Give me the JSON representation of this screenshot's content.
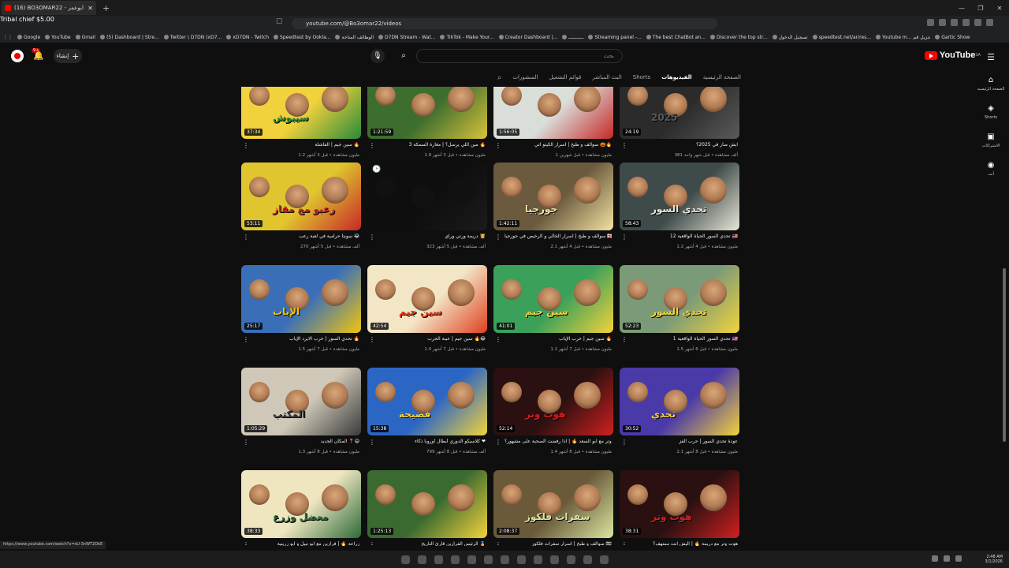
{
  "browser": {
    "tab_title": "(16) BO3OMAR22 - ابوعمر - YouTube",
    "overlay_text": "Tribal chief $5.00",
    "url": "youtube.com/@Bo3omar22/videos",
    "status_url": "https://www.youtube.com/watch?v=sU-3nWT2OkE",
    "bookmarks": [
      "Google",
      "YouTube",
      "Gmail",
      "(5) Dashboard | Stre...",
      "Twitter \\ D7DN (xD7...",
      "xD7DN - Twitch",
      "Speedtest by Ookla...",
      "الوظائف المتاحة",
      "D7DN Stream - Wat...",
      "TikTok - Make Your...",
      "Creator Dashboard |...",
      "ـــــــــــ",
      "Streaming panel -...",
      "The best ChatBot an...",
      "Discover the top str...",
      "تسجيل الدخول",
      "speedtest.net/ar/res...",
      "Youtube m... تنزيل قم",
      "Gartic Show"
    ]
  },
  "header": {
    "logo_text": "YouTube",
    "logo_region": "SA",
    "search_placeholder": "بحث",
    "create_label": "إنشاء",
    "notif_count": "9+"
  },
  "subnav": {
    "items": [
      "الصفحة الرئيسية",
      "الفيديوهات",
      "Shorts",
      "البث المباشر",
      "قوائم التشغيل",
      "المنشورات"
    ],
    "active": "الفيديوهات"
  },
  "rail": [
    {
      "label": "الصفحة الرئيسية",
      "icon": "home-icon",
      "glyph": "⌂"
    },
    {
      "label": "Shorts",
      "icon": "shorts-icon",
      "glyph": "◈"
    },
    {
      "label": "الاشتراكات",
      "icon": "subscriptions-icon",
      "glyph": "▣"
    },
    {
      "label": "أنت",
      "icon": "you-icon",
      "glyph": "◉"
    }
  ],
  "videos": [
    {
      "title": "سين جيم | الفاشلة 🔥",
      "meta": "1.2 مليون مشاهدة • قبل 3 أشهر",
      "duration": "37:34",
      "bg": "#f2d23c",
      "accent": "#2a8a3a",
      "text": "سيبوش"
    },
    {
      "title": "مين اللي يرسل؟ | مغارة السمكة 3 🔥",
      "meta": "1.9 مليون مشاهدة • قبل 3 أشهر",
      "duration": "1:21:59",
      "bg": "#3d6e2e",
      "accent": "#d8c23a",
      "text": ""
    },
    {
      "title": "سوالف و طبخ | اسرار الكيتو اتي 🎃🔥",
      "meta": "1 مليون مشاهدة • قبل شهرين",
      "duration": "1:56:05",
      "bg": "#d9ded9",
      "accent": "#c62828",
      "text": ""
    },
    {
      "title": "ايش صار في 2025؟",
      "meta": "381 ألف مشاهدة • قبل شهر واحد",
      "duration": "24:19",
      "bg": "#2b2b2b",
      "accent": "#5a5a5a",
      "text": "2025"
    },
    {
      "title": "سويتا حرامية في لعبة رعب 😂",
      "meta": "270 ألف مشاهدة • قبل 5 أشهر",
      "duration": "53:11",
      "bg": "#e0c52e",
      "accent": "#c62828",
      "text": "رعبو مع مقاز"
    },
    {
      "title": "دريمة ورتي وراي 👸",
      "meta": "323 ألف مشاهدة • قبل 5 أشهر",
      "duration": "",
      "bg": "#0e0e0e",
      "accent": "#1b1b1b",
      "text": ""
    },
    {
      "title": "سوالف و طبخ | اسرار الخالي و الرخيص في جورجيا 🇬🇪",
      "meta": "2.1 مليون مشاهدة • قبل 4 أشهر",
      "duration": "1:42:11",
      "bg": "#6b5a3e",
      "accent": "#f3e2a0",
      "text": "جورجيا"
    },
    {
      "title": "تحدي السور الحياة الواقعية 12 🇲🇾",
      "meta": "1.2 مليون مشاهدة • قبل 4 أشهر",
      "duration": "58:43",
      "bg": "#3f4a4a",
      "accent": "#e6e6d6",
      "text": "تحدي السور"
    },
    {
      "title": "تحدي السور | حرب الايرد الإياب 🔥",
      "meta": "1.5 مليون مشاهدة • قبل 7 أشهر",
      "duration": "25:17",
      "bg": "#3a6fb8",
      "accent": "#f1c40f",
      "text": "الإياب"
    },
    {
      "title": "سين جيم | عينة الحرب 🔥😂",
      "meta": "1.4 مليون مشاهدة • قبل 7 أشهر",
      "duration": "42:54",
      "bg": "#f2e6c6",
      "accent": "#e04020",
      "text": "سين جيم"
    },
    {
      "title": "سين جيم | حرب الإياب 🔥",
      "meta": "1.1 مليون مشاهدة • قبل 7 أشهر",
      "duration": "41:01",
      "bg": "#3aa05a",
      "accent": "#f3d23c",
      "text": "سين جيم"
    },
    {
      "title": "تحدي السور الحياة الواقعية 1 🇲🇾",
      "meta": "1.5 مليون مشاهدة • قبل 6 أشهر",
      "duration": "52:23",
      "bg": "#7a9a78",
      "accent": "#f3d23c",
      "text": "تحدي السور"
    },
    {
      "title": "المكان الجديد 📍😄",
      "meta": "1.3 مليون مشاهدة • قبل 8 أشهر",
      "duration": "1:05:29",
      "bg": "#cfc8b8",
      "accent": "#3b3b3b",
      "text": "المكتب"
    },
    {
      "title": "كلاسيكو الدوري أبطال أوروبا ذكاء ❤",
      "meta": "799 ألف مشاهدة • قبل 8 أشهر",
      "duration": "15:38",
      "bg": "#2b66c4",
      "accent": "#f3d23c",
      "text": "فضيحة"
    },
    {
      "title": "هوت وتر مع ابو السعد 🔥 | اذا رفضت الصحبة على مشهور؟",
      "meta": "1.4 مليون مشاهدة • قبل 8 أشهر",
      "duration": "52:14",
      "bg": "#2a1010",
      "accent": "#d02020",
      "text": "هوت وتر"
    },
    {
      "title": "عودة تحدي السور | حرب الفز",
      "meta": "2.1 مليون مشاهدة • قبل 8 أشهر",
      "duration": "30:52",
      "bg": "#4a3aa8",
      "accent": "#f3d23c",
      "text": "تحدي"
    },
    {
      "title": "زراعة 🔥 | فرازين مع ابو نبيل و ابو زرينية",
      "meta": "",
      "duration": "38:33",
      "bg": "#efe6c0",
      "accent": "#2e6a3a",
      "text": "معضل وزرع"
    },
    {
      "title": "الرئيس الفرازين قارئ التاريخ 🏅",
      "meta": "",
      "duration": "1:25:13",
      "bg": "#3a6a30",
      "accent": "#f3d23c",
      "text": ""
    },
    {
      "title": "سوالف و طبخ | اسرار سفرات فلكوز 🇸🇷",
      "meta": "",
      "duration": "2:08:37",
      "bg": "#6a5a3a",
      "accent": "#d9e6a0",
      "text": "سفرات فلكوز"
    },
    {
      "title": "هوت وتر مع دريمة 🔥 | اليش انت ممتهف؟",
      "meta": "",
      "duration": "38:31",
      "bg": "#2a1010",
      "accent": "#d02020",
      "text": "هوت وتر"
    }
  ],
  "taskbar": {
    "time": "2:48 AM",
    "date": "3/1/2026"
  }
}
